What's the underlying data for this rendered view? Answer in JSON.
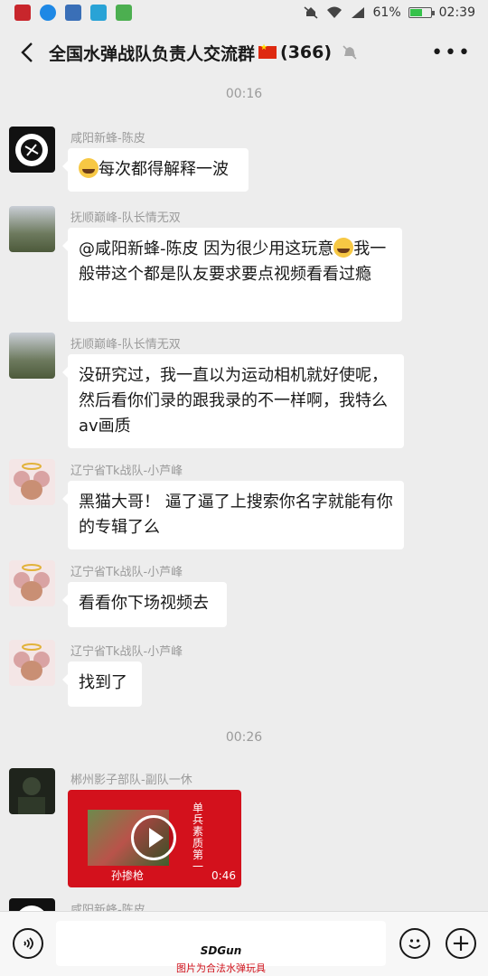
{
  "status_bar": {
    "battery_percent": "61%",
    "battery_level": 0.61,
    "time": "02:39",
    "app_icons": [
      "app-icon-red",
      "app-icon-blue",
      "app-icon-blue2",
      "app-icon-cloud",
      "app-icon-notify"
    ]
  },
  "header": {
    "title": "全国水弹战队负责人交流群",
    "member_count": "(366)",
    "back_icon": "back-chevron-icon",
    "mute_icon": "mute-bell-icon",
    "more_icon": "more-dots-icon"
  },
  "chat": {
    "timestamps": [
      "00:16",
      "00:26"
    ],
    "messages": [
      {
        "sender": "咸阳新蜂-陈皮",
        "text": "每次都得解释一波",
        "has_emoji_prefix": true
      },
      {
        "sender": "抚顺巅峰-队长情无双",
        "text_parts": [
          "@咸阳新蜂-陈皮  因为很少用这玩意",
          "我一般带这个都是队友要求要点视频看看过瘾"
        ]
      },
      {
        "sender": "抚顺巅峰-队长情无双",
        "text": "没研究过，我一直以为运动相机就好使呢，然后看你们录的跟我录的不一样啊，我特么av画质"
      },
      {
        "sender": "辽宁省Tk战队-小芦峰",
        "text": "黑猫大哥！   逼了逼了上搜索你名字就能有你的专辑了么"
      },
      {
        "sender": "辽宁省Tk战队-小芦峰",
        "text": "看看你下场视频去"
      },
      {
        "sender": "辽宁省Tk战队-小芦峰",
        "text": "找到了"
      },
      {
        "sender": "郴州影子部队-副队一休",
        "video": {
          "caption": "孙掺枪",
          "side_text": "单兵素质第一",
          "duration": "0:46"
        }
      },
      {
        "sender": "咸阳新蜂-陈皮"
      }
    ]
  },
  "input_bar": {
    "voice_icon": "voice-icon",
    "emoji_icon": "emoji-icon",
    "plus_icon": "plus-icon",
    "watermark_brand": "SDGun",
    "watermark_note": "图片为合法水弹玩具"
  },
  "colors": {
    "background": "#ededed",
    "bubble": "#ffffff",
    "video_bg": "#d3111c",
    "battery_green": "#35c24a"
  }
}
